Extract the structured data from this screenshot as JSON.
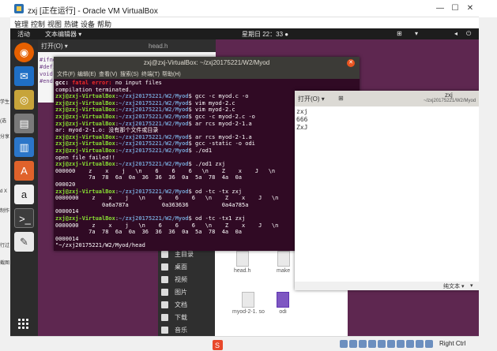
{
  "host_window": {
    "title": "zxj [正在运行] - Oracle VM VirtualBox",
    "controls": {
      "minimize": "—",
      "maximize": "☐",
      "close": "✕"
    },
    "menu": [
      "管理",
      "控制",
      "视图",
      "热键",
      "设备",
      "帮助"
    ]
  },
  "host_left_fragments": [
    "学生",
    "(选",
    "分享",
    "d X",
    "制作",
    "行过",
    "截图"
  ],
  "guest_topbar": {
    "activities": "活动",
    "app_menu": "文本编辑器 ▾",
    "clock": "星期日 22：33 ●"
  },
  "gedit_back": {
    "open_label": "打开(O) ▾",
    "filename": "head.h",
    "lines": [
      "#ifnde",
      "#defi",
      "void",
      "#endi"
    ]
  },
  "terminal": {
    "title": "zxj@zxj-VirtualBox: ~/zxj20175221/W2/Myod",
    "menu": [
      "文件(F)",
      "编辑(E)",
      "查看(V)",
      "搜索(S)",
      "终端(T)",
      "帮助(H)"
    ],
    "user": "zxj@zxj-VirtualBox",
    "path": "~/zxj20175221/W2/Myod",
    "lines": [
      {
        "kind": "error",
        "text_a": "gcc: ",
        "text_b": "fatal error: ",
        "text_c": "no input files"
      },
      {
        "kind": "plain",
        "text": "compilation terminated."
      },
      {
        "kind": "cmd",
        "cmd": "gcc -c myod.c -o"
      },
      {
        "kind": "cmd",
        "cmd": "vim myod-2.c"
      },
      {
        "kind": "cmd",
        "cmd": "vim myod-2.c"
      },
      {
        "kind": "cmd",
        "cmd": "gcc -c myod-2.c -o"
      },
      {
        "kind": "cmd",
        "cmd": "ar rcs myod-2-1.a"
      },
      {
        "kind": "plain",
        "text": "ar: myod-2-1.o: 没有那个文件或目录"
      },
      {
        "kind": "cmd",
        "cmd": "ar rcs myod-2-1.a"
      },
      {
        "kind": "cmd",
        "cmd": "gcc -static -o odi"
      },
      {
        "kind": "cmd",
        "cmd": "./od1"
      },
      {
        "kind": "plain",
        "text": "open file failed!!"
      },
      {
        "kind": "cmd",
        "cmd": "./od1 zxj"
      },
      {
        "kind": "plain",
        "text": "000000    z    x    j   \\n    6    6    6   \\n    Z    x    J   \\n"
      },
      {
        "kind": "plain",
        "text": "          7a  78  6a  0a  36  36  36  0a  5a  78  4a  0a"
      },
      {
        "kind": "plain",
        "text": "000020"
      },
      {
        "kind": "cmd",
        "cmd": "od -tc -tx zxj"
      },
      {
        "kind": "plain",
        "text": "0000000    z    x    j   \\n    6    6    6   \\n    Z    x    J   \\n"
      },
      {
        "kind": "plain",
        "text": "              0a6a787a          0a363636          0a4a785a"
      },
      {
        "kind": "plain",
        "text": "0000014"
      },
      {
        "kind": "cmd",
        "cmd": "od -tc -tx1 zxj"
      },
      {
        "kind": "plain",
        "text": "0000000    z    x    j   \\n    6    6    6   \\n    Z    x    J   \\n"
      },
      {
        "kind": "plain",
        "text": "          7a  78  6a  0a  36  36  36  0a  5a  78  4a  0a"
      },
      {
        "kind": "plain",
        "text": "0000014"
      },
      {
        "kind": "plain",
        "text": "\"~/zxj20175221/W2/Myod/head"
      }
    ]
  },
  "gedit_front": {
    "open_label": "打开(O) ▾",
    "filename": "zxj",
    "path": "~/zxj20175221/W2/Myod",
    "lines": [
      "zxj",
      "666",
      "ZxJ"
    ],
    "status": {
      "mode": "纯文本 ▾",
      "tab": "▾"
    }
  },
  "file_manager": {
    "sidebar": [
      "主目录",
      "桌面",
      "视频",
      "图片",
      "文档",
      "下载",
      "音乐"
    ],
    "files": [
      "head.h",
      "make",
      "myod-2-1.\nso",
      "odi"
    ]
  },
  "vbox_status": {
    "hotkey": "Right Ctrl"
  }
}
